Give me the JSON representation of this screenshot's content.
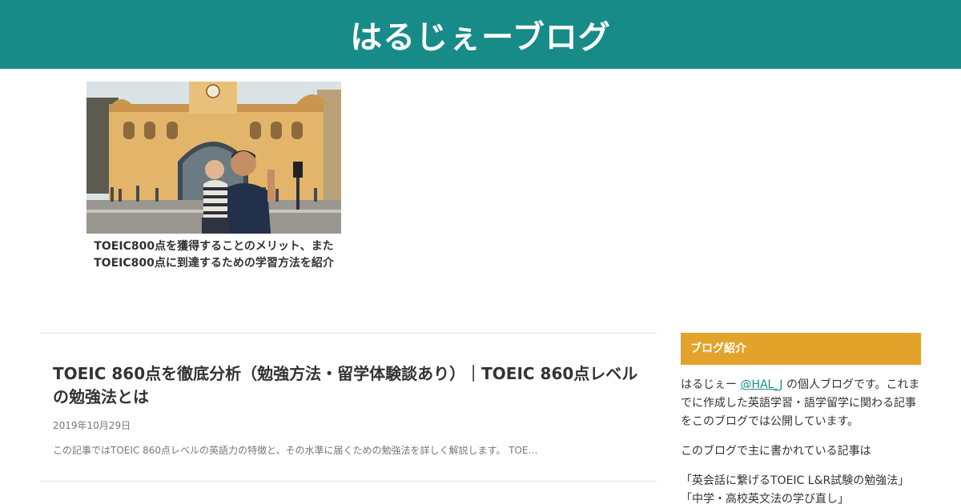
{
  "header": {
    "site_title": "はるじぇーブログ"
  },
  "featured": {
    "title": "TOEIC800点を獲得することのメリット、またTOEIC800点に到達するための学習方法を紹介"
  },
  "articles": [
    {
      "title": "TOEIC 860点を徹底分析（勉強方法・留学体験談あり）｜TOEIC 860点レベルの勉強法とは",
      "date": "2019年10月29日",
      "excerpt": "この記事ではTOEIC 860点レベルの英語力の特徴と、その水準に届くための勉強法を詳しく解説します。 TOE…"
    }
  ],
  "sidebar": {
    "widget_title": "ブログ紹介",
    "intro_prefix": "はるじぇー ",
    "intro_link": "@HAL_J",
    "intro_suffix": " の個人ブログです。これまでに作成した英語学習・語学留学に関わる記事をこのブログでは公開しています。",
    "topics_lead": "このブログで主に書かれている記事は",
    "topics": [
      "「英会話に繋げるTOEIC L&R試験の勉強法」",
      "「中学・高校英文法の学び直し」"
    ]
  },
  "colors": {
    "header_bg": "#178b88",
    "widget_title_bg": "#e3a32a",
    "link": "#178b88"
  }
}
